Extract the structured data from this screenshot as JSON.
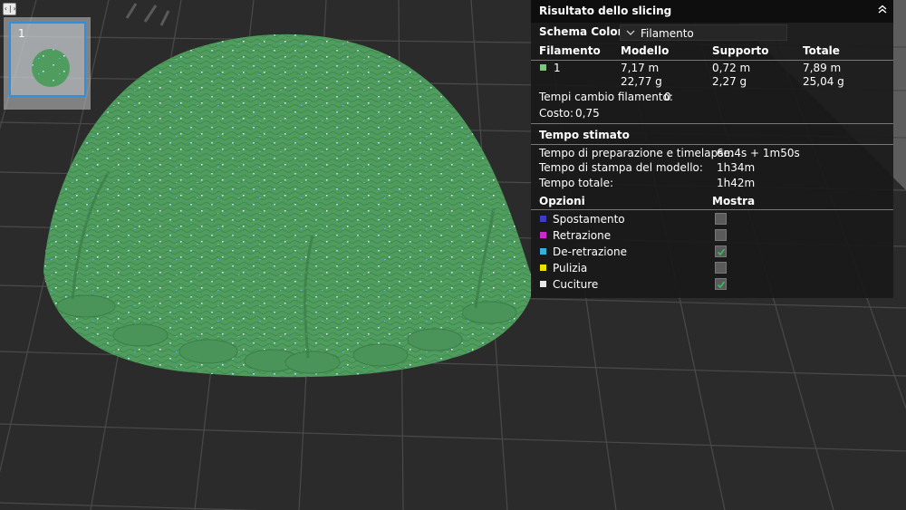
{
  "header_toggle": "‹|›",
  "plate": {
    "thumbnail_number": "1"
  },
  "slicing_panel": {
    "title": "Risultato dello slicing",
    "collapse_icon": "chevron-up-icon",
    "color_scheme": {
      "label": "Schema Colore",
      "value": "Filamento"
    },
    "table": {
      "headers": [
        "Filamento",
        "Modello",
        "Supporto",
        "Totale"
      ],
      "row": {
        "filament": "1",
        "swatch_color": "#7fc47f",
        "model_length": "7,17 m",
        "model_weight": "22,77 g",
        "support_length": "0,72 m",
        "support_weight": "2,27 g",
        "total_length": "7,89 m",
        "total_weight": "25,04 g"
      }
    },
    "filament_changes": {
      "label": "Tempi cambio filamento:",
      "value": "0"
    },
    "cost": {
      "label": "Costo:",
      "value": "0,75"
    },
    "estimated_time": {
      "heading": "Tempo stimato",
      "items": [
        {
          "label": "Tempo di preparazione e timelapse:",
          "value": "6m4s + 1m50s"
        },
        {
          "label": "Tempo di stampa del modello:",
          "value": "1h34m"
        },
        {
          "label": "Tempo totale:",
          "value": "1h42m"
        }
      ]
    },
    "options": {
      "heading": "Opzioni",
      "show_heading": "Mostra",
      "items": [
        {
          "label": "Spostamento",
          "color": "#3c3cc8",
          "checked": false
        },
        {
          "label": "Retrazione",
          "color": "#d028d0",
          "checked": false
        },
        {
          "label": "De-retrazione",
          "color": "#38b0d8",
          "checked": true
        },
        {
          "label": "Pulizia",
          "color": "#f0e000",
          "checked": false
        },
        {
          "label": "Cuciture",
          "color": "#e8e8e8",
          "checked": true
        }
      ]
    }
  }
}
